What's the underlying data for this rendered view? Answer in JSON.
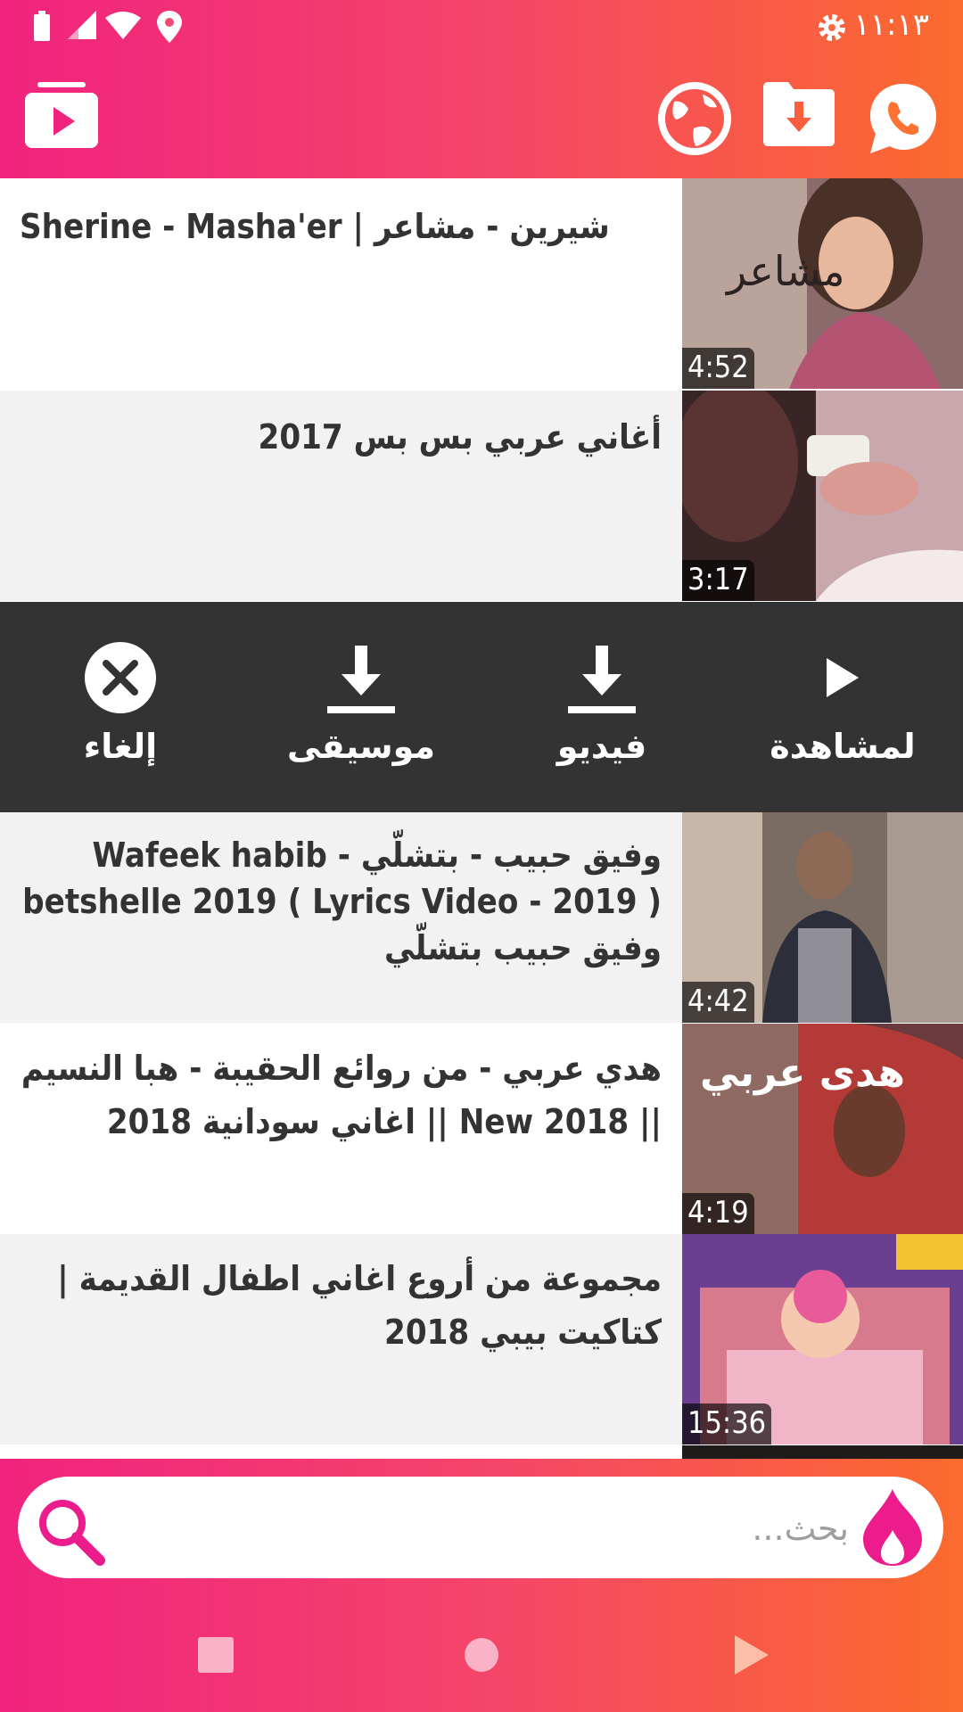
{
  "status": {
    "time": "١١:١٣"
  },
  "actions": {
    "watch": "لمشاهدة",
    "video": "فيديو",
    "music": "موسيقى",
    "cancel": "إلغاء"
  },
  "videos": [
    {
      "title": "Sherine - Masha'er | شيرين - مشاعر",
      "duration": "4:52"
    },
    {
      "title": "أغاني عربي بس بس 2017",
      "duration": "3:17"
    },
    {
      "title": "وفيق حبيب - بتشلّي - Wafeek habib betshelle 2019 ( Lyrics Video - 2019 ) وفيق حبيب بتشلّي",
      "duration": "4:42"
    },
    {
      "title": "هدي عربي - من روائع الحقيبة - هبا النسيم || New 2018 || اغاني سودانية 2018",
      "duration": "4:19"
    },
    {
      "title": "مجموعة من أروع اغاني اطفال القديمة | كتاكيت بيبي 2018",
      "duration": "15:36"
    }
  ],
  "search": {
    "placeholder": "بحث..."
  },
  "colors": {
    "gradient_start": "#f0237e",
    "gradient_end": "#fb6b2d",
    "accent": "#ec1c8c",
    "overlay": "#333333"
  }
}
